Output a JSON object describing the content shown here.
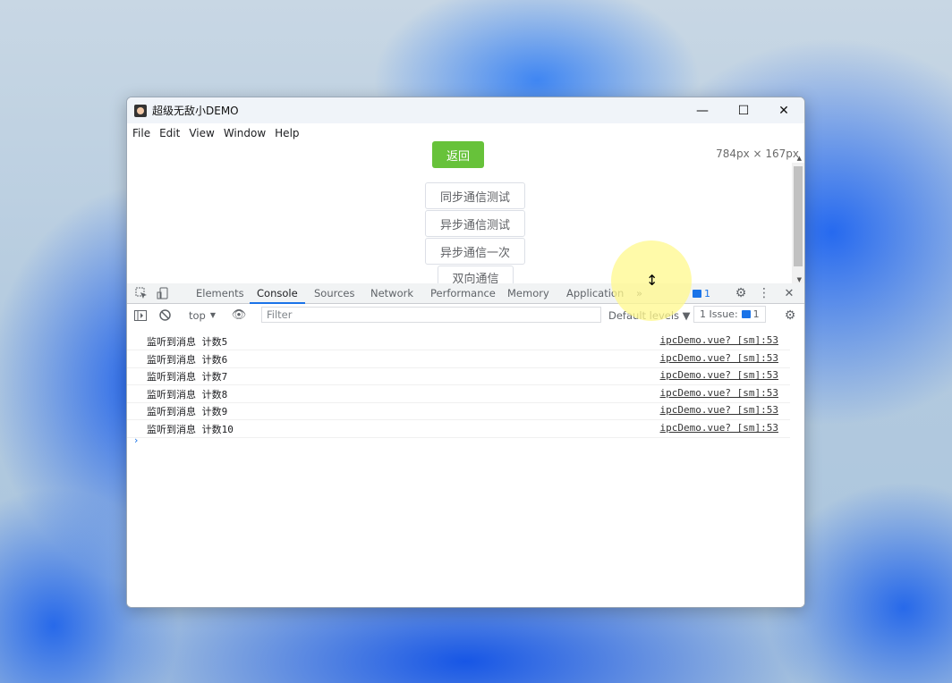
{
  "window": {
    "title": "超级无敌小DEMO",
    "controls": {
      "minimize": "—",
      "maximize": "☐",
      "close": "✕"
    }
  },
  "menu": [
    "File",
    "Edit",
    "View",
    "Window",
    "Help"
  ],
  "page": {
    "back_button": "返回",
    "dimensions": "784px × 167px",
    "buttons": [
      "同步通信测试",
      "异步通信测试",
      "异步通信一次",
      "双向通信"
    ]
  },
  "devtools": {
    "tabs": [
      "Elements",
      "Console",
      "Sources",
      "Network",
      "Performance",
      "Memory",
      "Application"
    ],
    "active_tab": "Console",
    "more": "»",
    "message_badge": "1",
    "toolbar": {
      "context": "top",
      "filter_placeholder": "Filter",
      "levels": "Default levels ▼",
      "issues_label": "1 Issue:",
      "issues_count": "1"
    },
    "logs": [
      {
        "message": "监听到消息 计数5",
        "source": "ipcDemo.vue? [sm]:53"
      },
      {
        "message": "监听到消息 计数6",
        "source": "ipcDemo.vue? [sm]:53"
      },
      {
        "message": "监听到消息 计数7",
        "source": "ipcDemo.vue? [sm]:53"
      },
      {
        "message": "监听到消息 计数8",
        "source": "ipcDemo.vue? [sm]:53"
      },
      {
        "message": "监听到消息 计数9",
        "source": "ipcDemo.vue? [sm]:53"
      },
      {
        "message": "监听到消息 计数10",
        "source": "ipcDemo.vue? [sm]:53"
      }
    ],
    "prompt": "›"
  }
}
